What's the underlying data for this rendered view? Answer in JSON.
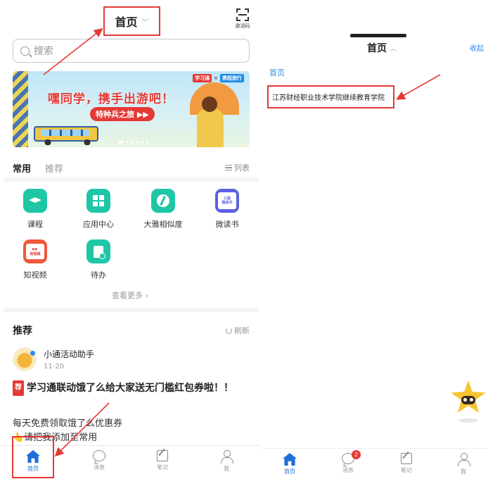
{
  "left": {
    "header": {
      "title": "首页",
      "scan_label": "邀请码"
    },
    "search": {
      "placeholder": "搜索"
    },
    "banner": {
      "logo_xxt": "学习通",
      "logo_x": "×",
      "logo_trip": "携程旅行",
      "title": "嘿同学，携手出游吧！",
      "tag": "特种兵之旅 ▶▶"
    },
    "tabs": {
      "common": "常用",
      "recommend": "推荐",
      "list": "列表"
    },
    "apps": [
      {
        "label": "课程",
        "icon": "graduation-cap-icon"
      },
      {
        "label": "应用中心",
        "icon": "app-grid-icon"
      },
      {
        "label": "大雅相似度",
        "icon": "similarity-icon"
      },
      {
        "label": "微读书",
        "icon": "micro-reading-icon",
        "card_top": "三面",
        "card_bottom": "微读书"
      },
      {
        "label": "知视频",
        "icon": "video-icon",
        "card_text": "知视频"
      },
      {
        "label": "待办",
        "icon": "todo-icon"
      }
    ],
    "see_more": "查看更多 ›",
    "recommend": {
      "title": "推荐",
      "refresh": "刷新",
      "author": "小通活动助手",
      "date": "11-20",
      "tag": "荐",
      "post_title": "学习通联动饿了么给大家送无门槛红包券啦！！",
      "body_line1": "每天免费领取饿了么优惠券",
      "body_line2": "👆请把我添加至常用"
    },
    "tabbar": [
      {
        "label": "首页",
        "icon": "home-icon"
      },
      {
        "label": "消息",
        "icon": "message-icon"
      },
      {
        "label": "笔记",
        "icon": "note-icon"
      },
      {
        "label": "我",
        "icon": "profile-icon"
      }
    ]
  },
  "right": {
    "title": "首页",
    "collapse": "收起",
    "sub": "首页",
    "unit": "江苏财经职业技术学院继续教育学院",
    "tabbar": [
      {
        "label": "首页",
        "icon": "home-icon"
      },
      {
        "label": "消息",
        "icon": "message-icon",
        "badge": "2"
      },
      {
        "label": "笔记",
        "icon": "note-icon"
      },
      {
        "label": "我",
        "icon": "profile-icon"
      }
    ]
  },
  "colors": {
    "accent": "#1e6fd9",
    "highlight": "#e53935",
    "teal": "#1fc6a6",
    "link": "#2d8cf0"
  }
}
